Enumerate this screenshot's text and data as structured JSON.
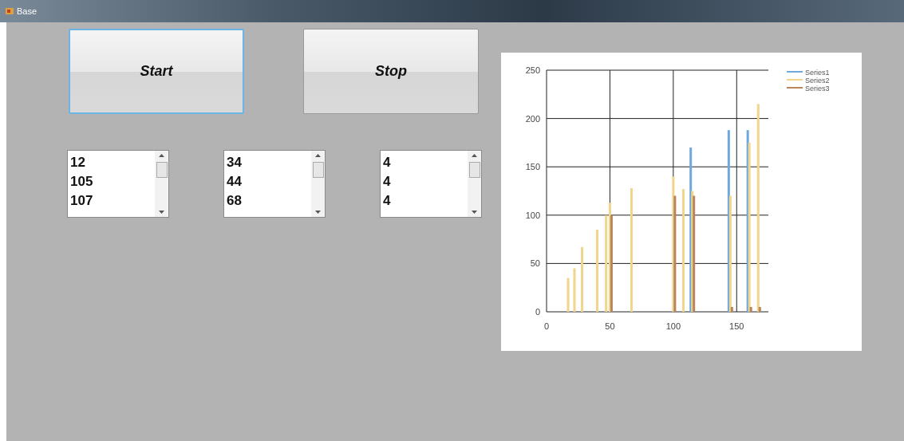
{
  "window": {
    "title": "Base"
  },
  "buttons": [
    {
      "label": "Start",
      "focused": true
    },
    {
      "label": "Stop",
      "focused": false
    }
  ],
  "lists": [
    {
      "items": [
        "12",
        "105",
        "107"
      ]
    },
    {
      "items": [
        "34",
        "44",
        "68"
      ]
    },
    {
      "items": [
        "4",
        "4",
        "4"
      ]
    }
  ],
  "chart": {
    "chart_data": {
      "type": "bar",
      "grid": true,
      "legend": "top right",
      "xlim": [
        0,
        175
      ],
      "ylim": [
        0,
        250
      ],
      "xticks": [
        0,
        50,
        100,
        150
      ],
      "yticks": [
        0,
        50,
        100,
        150,
        200,
        250
      ],
      "x": [
        17,
        22,
        28,
        40,
        47,
        50,
        67,
        100,
        108,
        115,
        145,
        160,
        167
      ],
      "series": [
        {
          "name": "Series1",
          "color": "#6fa8dc",
          "values": [
            null,
            null,
            null,
            null,
            null,
            null,
            null,
            null,
            null,
            170,
            188,
            188,
            null
          ]
        },
        {
          "name": "Series2",
          "color": "#f0d58c",
          "values": [
            35,
            45,
            67,
            85,
            100,
            113,
            128,
            140,
            127,
            125,
            120,
            175,
            215
          ]
        },
        {
          "name": "Series3",
          "color": "#b8865a",
          "values": [
            null,
            null,
            null,
            null,
            null,
            100,
            null,
            120,
            null,
            120,
            5,
            5,
            5
          ]
        }
      ]
    }
  }
}
